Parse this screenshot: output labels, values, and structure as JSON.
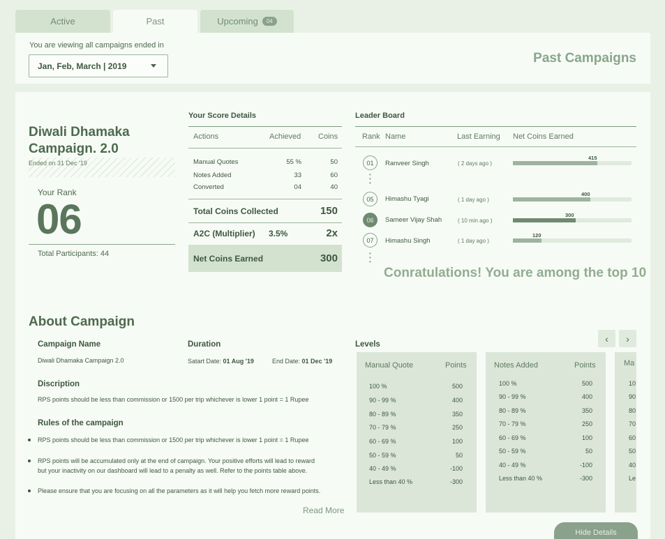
{
  "tabs": [
    {
      "label": "Active"
    },
    {
      "label": "Past"
    },
    {
      "label": "Upcoming",
      "badge": "04"
    }
  ],
  "filter": {
    "label": "You are viewing all campaigns ended in",
    "value": "Jan, Feb, March  |  2019"
  },
  "page_title": "Past Campaigns",
  "campaign": {
    "title_line1": "Diwali Dhamaka",
    "title_line2": "Campaign. 2.0",
    "ended": "Ended on 31 Dec '19",
    "rank_label": "Your Rank",
    "rank": "06",
    "participants": "Total Participants: 44"
  },
  "score": {
    "title": "Your Score Details",
    "headers": {
      "actions": "Actions",
      "achieved": "Achieved",
      "coins": "Coins"
    },
    "rows": [
      {
        "action": "Manual Quotes",
        "achieved": "55 %",
        "coins": "50"
      },
      {
        "action": "Notes Added",
        "achieved": "33",
        "coins": "60"
      },
      {
        "action": "Converted",
        "achieved": "04",
        "coins": "40"
      }
    ],
    "total_label": "Total Coins Collected",
    "total_value": "150",
    "multiplier_label": "A2C (Multiplier)",
    "multiplier_pct": "3.5%",
    "multiplier_value": "2x",
    "net_label": "Net Coins Earned",
    "net_value": "300"
  },
  "leaderboard": {
    "title": "Leader Board",
    "headers": {
      "rank": "Rank",
      "name": "Name",
      "last": "Last Earning",
      "net": "Net Coins Earned"
    },
    "rows": [
      {
        "rank": "01",
        "name": "Ranveer Singh",
        "when": "( 2 days ago )",
        "coins": "415",
        "fraction": 0.71
      },
      {
        "rank": "05",
        "name": "Himashu Tyagi",
        "when": "( 1 day ago )",
        "coins": "400",
        "fraction": 0.65
      },
      {
        "rank": "06",
        "name": "Sameer Vijay Shah",
        "when": "( 10 min ago )",
        "coins": "300",
        "fraction": 0.53
      },
      {
        "rank": "07",
        "name": "Himashu Singh",
        "when": "( 1 day ago )",
        "coins": "120",
        "fraction": 0.24
      }
    ],
    "congrats": "Conratulations! You are among the top 10"
  },
  "about": {
    "title": "About Campaign",
    "name_label": "Campaign Name",
    "name_value": "Diwali Dhamaka Campaign 2.0",
    "duration_label": "Duration",
    "start_label": "Satart Date:",
    "start_value": "01 Aug '19",
    "end_label": "End Date:",
    "end_value": "01 Dec '19",
    "desc_label": "Discription",
    "desc_text": "RPS points should be less than commission or 1500 per trip whichever is lower 1 point = 1 Rupee",
    "rules_label": "Rules of the campaign",
    "rules": [
      "RPS points should be less than commission or 1500 per trip whichever is lower 1 point = 1 Rupee",
      "RPS points will be accumulated only at the end of campaign. Your positive efforts will lead to reward",
      "but your inactivity on our dashboard will lead to a penalty as well. Refer to the points table above.",
      "Please ensure that you are focusing on all the parameters as it will help you fetch more reward points."
    ],
    "read_more": "Read More"
  },
  "levels": {
    "title": "Levels",
    "cards": [
      {
        "head": "Manual Quote",
        "points_head": "Points",
        "rows": [
          [
            "100 %",
            "500"
          ],
          [
            "90 - 99 %",
            "400"
          ],
          [
            "80 - 89 %",
            "350"
          ],
          [
            "70 - 79 %",
            "250"
          ],
          [
            "60 - 69 %",
            "100"
          ],
          [
            "50 - 59 %",
            "50"
          ],
          [
            "40 - 49 %",
            "-100"
          ],
          [
            "Less than 40 %",
            "-300"
          ]
        ]
      },
      {
        "head": "Notes Added",
        "points_head": "Points",
        "rows": [
          [
            "100 %",
            "500"
          ],
          [
            "90 - 99 %",
            "400"
          ],
          [
            "80 - 89 %",
            "350"
          ],
          [
            "70 - 79 %",
            "250"
          ],
          [
            "60 - 69 %",
            "100"
          ],
          [
            "50 - 59 %",
            "50"
          ],
          [
            "40 - 49 %",
            "-100"
          ],
          [
            "Less than 40 %",
            "-300"
          ]
        ]
      },
      {
        "head": "Ma",
        "rows": [
          [
            "10"
          ],
          [
            "90"
          ],
          [
            "80"
          ],
          [
            "70"
          ],
          [
            "60"
          ],
          [
            "50"
          ],
          [
            "40"
          ],
          [
            "Le"
          ]
        ]
      }
    ]
  },
  "hide_details": "Hide Details"
}
